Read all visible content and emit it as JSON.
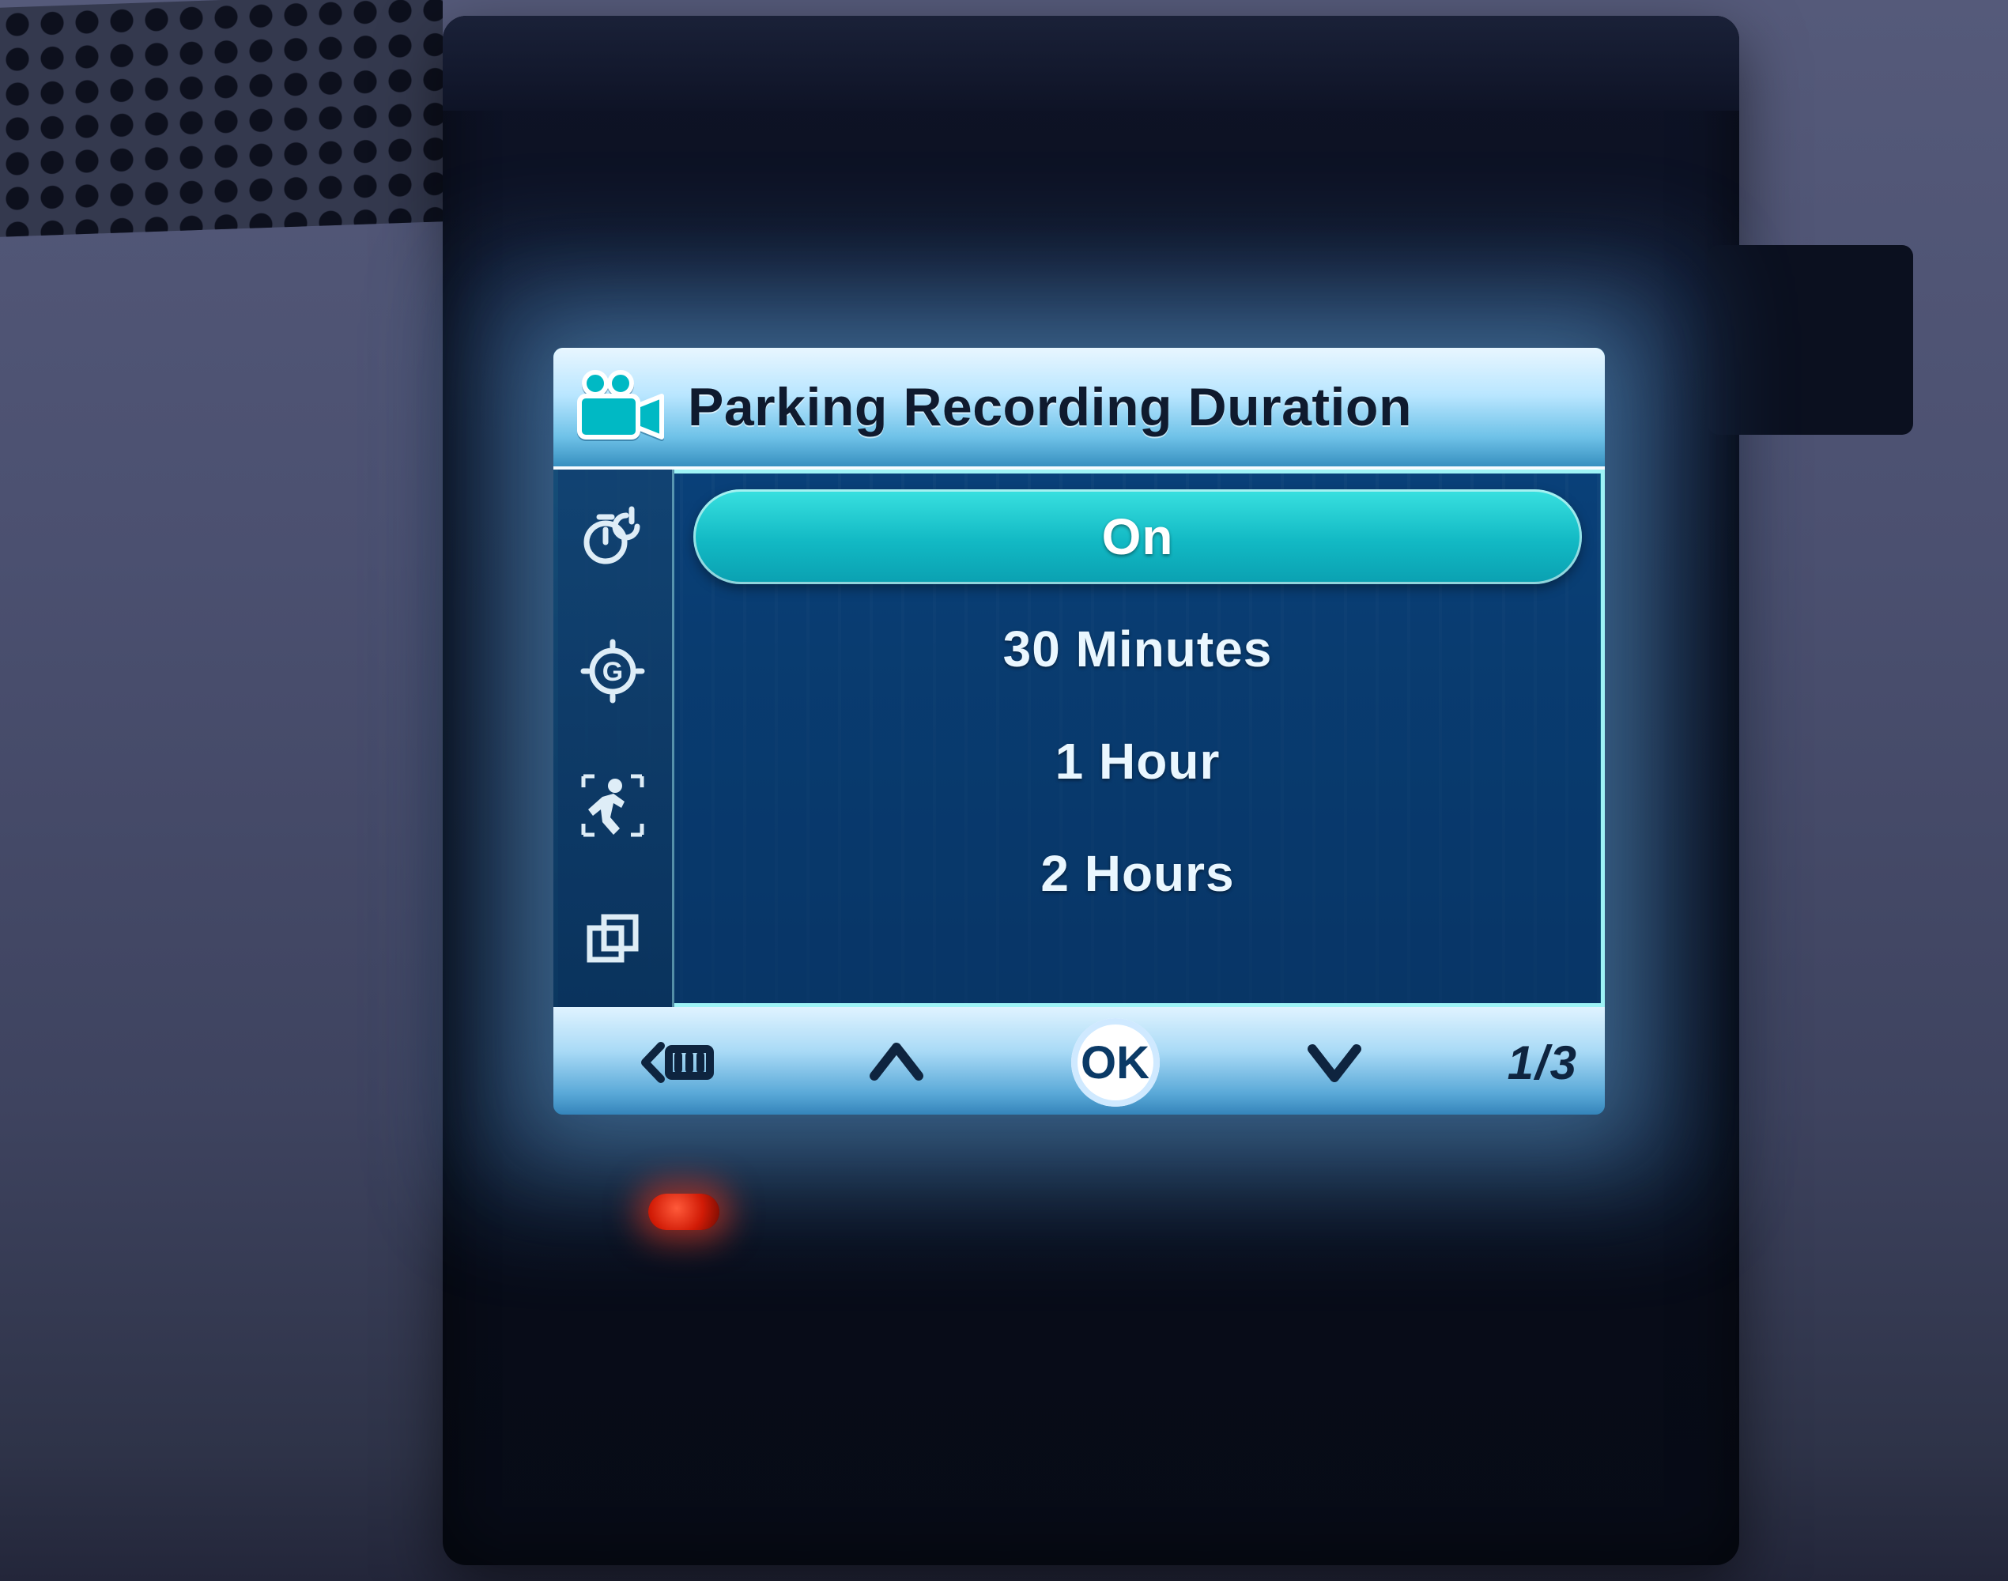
{
  "header": {
    "icon": "video-camera-icon",
    "title": "Parking Recording Duration"
  },
  "sidebar": {
    "items": [
      {
        "icon": "timer-power-icon"
      },
      {
        "icon": "g-sensor-icon"
      },
      {
        "icon": "motion-detect-icon"
      },
      {
        "icon": "overlap-icon"
      }
    ]
  },
  "options": [
    {
      "label": "On",
      "selected": true
    },
    {
      "label": "30 Minutes",
      "selected": false
    },
    {
      "label": "1 Hour",
      "selected": false
    },
    {
      "label": "2 Hours",
      "selected": false
    }
  ],
  "footer": {
    "back_icon": "back-icon",
    "up_icon": "up-arrow-icon",
    "ok_label": "OK",
    "down_icon": "down-arrow-icon",
    "page_indicator": "1/3"
  },
  "device": {
    "rec_led": "REC"
  }
}
